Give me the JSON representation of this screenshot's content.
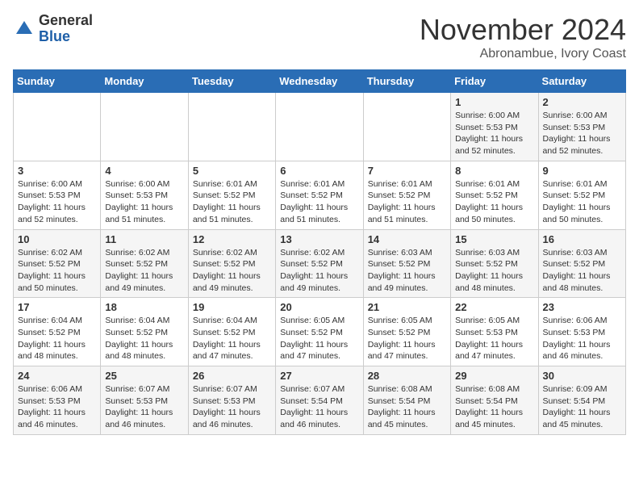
{
  "header": {
    "logo_general": "General",
    "logo_blue": "Blue",
    "month_title": "November 2024",
    "location": "Abronambue, Ivory Coast"
  },
  "days_of_week": [
    "Sunday",
    "Monday",
    "Tuesday",
    "Wednesday",
    "Thursday",
    "Friday",
    "Saturday"
  ],
  "weeks": [
    [
      {
        "day": "",
        "info": ""
      },
      {
        "day": "",
        "info": ""
      },
      {
        "day": "",
        "info": ""
      },
      {
        "day": "",
        "info": ""
      },
      {
        "day": "",
        "info": ""
      },
      {
        "day": "1",
        "info": "Sunrise: 6:00 AM\nSunset: 5:53 PM\nDaylight: 11 hours\nand 52 minutes."
      },
      {
        "day": "2",
        "info": "Sunrise: 6:00 AM\nSunset: 5:53 PM\nDaylight: 11 hours\nand 52 minutes."
      }
    ],
    [
      {
        "day": "3",
        "info": "Sunrise: 6:00 AM\nSunset: 5:53 PM\nDaylight: 11 hours\nand 52 minutes."
      },
      {
        "day": "4",
        "info": "Sunrise: 6:00 AM\nSunset: 5:53 PM\nDaylight: 11 hours\nand 51 minutes."
      },
      {
        "day": "5",
        "info": "Sunrise: 6:01 AM\nSunset: 5:52 PM\nDaylight: 11 hours\nand 51 minutes."
      },
      {
        "day": "6",
        "info": "Sunrise: 6:01 AM\nSunset: 5:52 PM\nDaylight: 11 hours\nand 51 minutes."
      },
      {
        "day": "7",
        "info": "Sunrise: 6:01 AM\nSunset: 5:52 PM\nDaylight: 11 hours\nand 51 minutes."
      },
      {
        "day": "8",
        "info": "Sunrise: 6:01 AM\nSunset: 5:52 PM\nDaylight: 11 hours\nand 50 minutes."
      },
      {
        "day": "9",
        "info": "Sunrise: 6:01 AM\nSunset: 5:52 PM\nDaylight: 11 hours\nand 50 minutes."
      }
    ],
    [
      {
        "day": "10",
        "info": "Sunrise: 6:02 AM\nSunset: 5:52 PM\nDaylight: 11 hours\nand 50 minutes."
      },
      {
        "day": "11",
        "info": "Sunrise: 6:02 AM\nSunset: 5:52 PM\nDaylight: 11 hours\nand 49 minutes."
      },
      {
        "day": "12",
        "info": "Sunrise: 6:02 AM\nSunset: 5:52 PM\nDaylight: 11 hours\nand 49 minutes."
      },
      {
        "day": "13",
        "info": "Sunrise: 6:02 AM\nSunset: 5:52 PM\nDaylight: 11 hours\nand 49 minutes."
      },
      {
        "day": "14",
        "info": "Sunrise: 6:03 AM\nSunset: 5:52 PM\nDaylight: 11 hours\nand 49 minutes."
      },
      {
        "day": "15",
        "info": "Sunrise: 6:03 AM\nSunset: 5:52 PM\nDaylight: 11 hours\nand 48 minutes."
      },
      {
        "day": "16",
        "info": "Sunrise: 6:03 AM\nSunset: 5:52 PM\nDaylight: 11 hours\nand 48 minutes."
      }
    ],
    [
      {
        "day": "17",
        "info": "Sunrise: 6:04 AM\nSunset: 5:52 PM\nDaylight: 11 hours\nand 48 minutes."
      },
      {
        "day": "18",
        "info": "Sunrise: 6:04 AM\nSunset: 5:52 PM\nDaylight: 11 hours\nand 48 minutes."
      },
      {
        "day": "19",
        "info": "Sunrise: 6:04 AM\nSunset: 5:52 PM\nDaylight: 11 hours\nand 47 minutes."
      },
      {
        "day": "20",
        "info": "Sunrise: 6:05 AM\nSunset: 5:52 PM\nDaylight: 11 hours\nand 47 minutes."
      },
      {
        "day": "21",
        "info": "Sunrise: 6:05 AM\nSunset: 5:52 PM\nDaylight: 11 hours\nand 47 minutes."
      },
      {
        "day": "22",
        "info": "Sunrise: 6:05 AM\nSunset: 5:53 PM\nDaylight: 11 hours\nand 47 minutes."
      },
      {
        "day": "23",
        "info": "Sunrise: 6:06 AM\nSunset: 5:53 PM\nDaylight: 11 hours\nand 46 minutes."
      }
    ],
    [
      {
        "day": "24",
        "info": "Sunrise: 6:06 AM\nSunset: 5:53 PM\nDaylight: 11 hours\nand 46 minutes."
      },
      {
        "day": "25",
        "info": "Sunrise: 6:07 AM\nSunset: 5:53 PM\nDaylight: 11 hours\nand 46 minutes."
      },
      {
        "day": "26",
        "info": "Sunrise: 6:07 AM\nSunset: 5:53 PM\nDaylight: 11 hours\nand 46 minutes."
      },
      {
        "day": "27",
        "info": "Sunrise: 6:07 AM\nSunset: 5:54 PM\nDaylight: 11 hours\nand 46 minutes."
      },
      {
        "day": "28",
        "info": "Sunrise: 6:08 AM\nSunset: 5:54 PM\nDaylight: 11 hours\nand 45 minutes."
      },
      {
        "day": "29",
        "info": "Sunrise: 6:08 AM\nSunset: 5:54 PM\nDaylight: 11 hours\nand 45 minutes."
      },
      {
        "day": "30",
        "info": "Sunrise: 6:09 AM\nSunset: 5:54 PM\nDaylight: 11 hours\nand 45 minutes."
      }
    ]
  ]
}
